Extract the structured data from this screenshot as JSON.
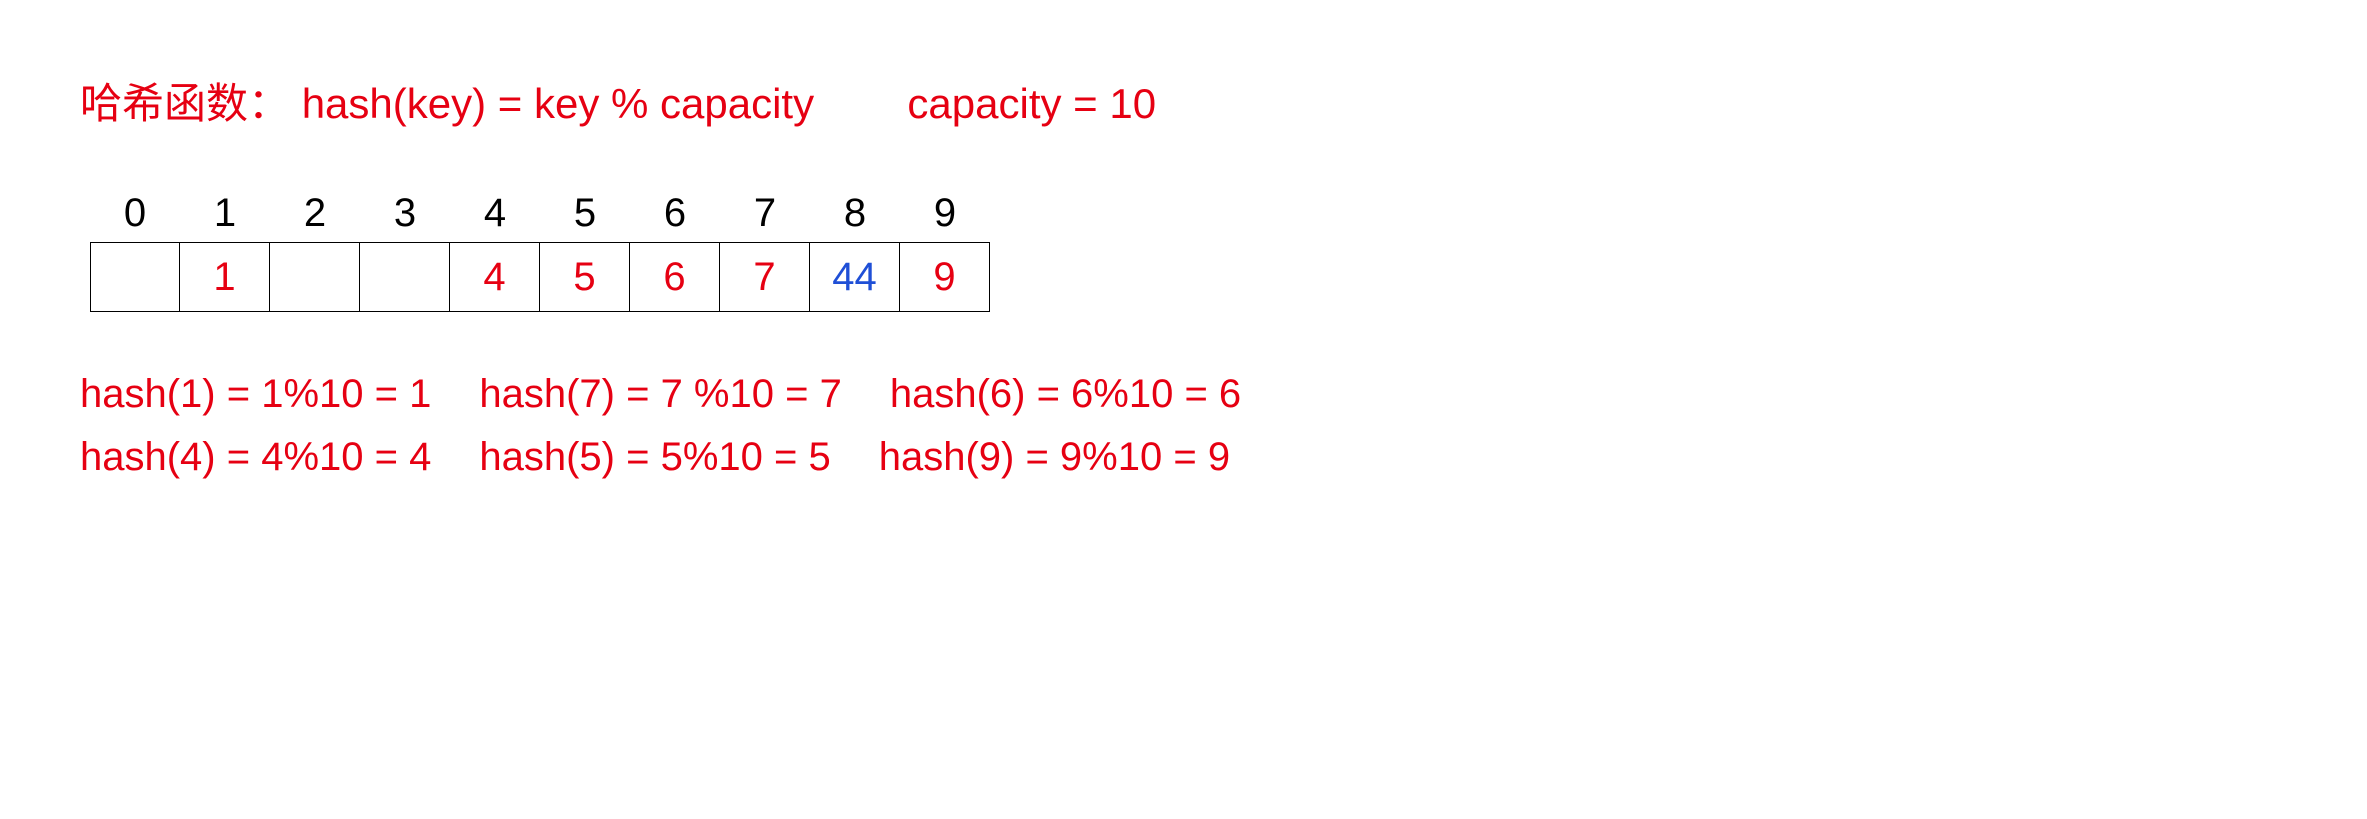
{
  "header": {
    "label": "哈希函数：",
    "formula": "hash(key) = key % capacity",
    "capacity_line": "capacity = 10"
  },
  "table": {
    "indices": [
      "0",
      "1",
      "2",
      "3",
      "4",
      "5",
      "6",
      "7",
      "8",
      "9"
    ],
    "cells": [
      {
        "value": "",
        "color": "red"
      },
      {
        "value": "1",
        "color": "red"
      },
      {
        "value": "",
        "color": "red"
      },
      {
        "value": "",
        "color": "red"
      },
      {
        "value": "4",
        "color": "red"
      },
      {
        "value": "5",
        "color": "red"
      },
      {
        "value": "6",
        "color": "red"
      },
      {
        "value": "7",
        "color": "red"
      },
      {
        "value": "44",
        "color": "blue"
      },
      {
        "value": "9",
        "color": "red"
      }
    ]
  },
  "calcs": {
    "row1": {
      "c1": "hash(1) = 1%10 = 1",
      "c2": "hash(7) = 7 %10 = 7",
      "c3": "hash(6) = 6%10 = 6"
    },
    "row2": {
      "c1": "hash(4) = 4%10 = 4",
      "c2": "hash(5) = 5%10 = 5",
      "c3": "hash(9) = 9%10 = 9"
    }
  }
}
